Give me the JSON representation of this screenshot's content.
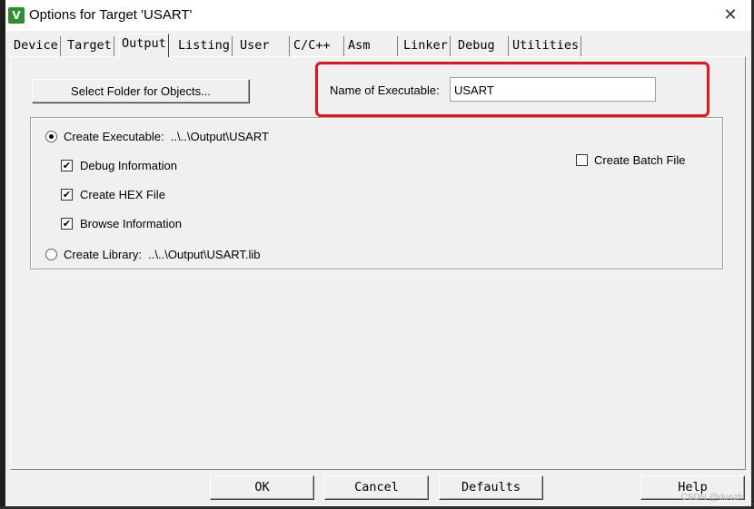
{
  "window": {
    "title": "Options for Target 'USART'",
    "icon": "V",
    "close_glyph": "✕"
  },
  "tabs": [
    {
      "label": "Device"
    },
    {
      "label": "Target"
    },
    {
      "label": "Output",
      "active": true
    },
    {
      "label": "Listing"
    },
    {
      "label": "User"
    },
    {
      "label": "C/C++"
    },
    {
      "label": "Asm"
    },
    {
      "label": "Linker"
    },
    {
      "label": "Debug"
    },
    {
      "label": "Utilities"
    }
  ],
  "output": {
    "select_folder_label": "Select Folder for Objects...",
    "name_of_executable_label": "Name of Executable:",
    "name_of_executable_value": "USART",
    "create_executable": {
      "label": "Create Executable:  ..\\..\\Output\\USART",
      "selected": true
    },
    "debug_information": {
      "label": "Debug Information",
      "checked": true
    },
    "create_hex_file": {
      "label": "Create HEX File",
      "checked": true
    },
    "browse_information": {
      "label": "Browse Information",
      "checked": true
    },
    "create_library": {
      "label": "Create Library:  ..\\..\\Output\\USART.lib",
      "selected": false
    },
    "create_batch_file": {
      "label": "Create Batch File",
      "checked": false
    }
  },
  "footer": {
    "ok": "OK",
    "cancel": "Cancel",
    "defaults": "Defaults",
    "help": "Help"
  },
  "watermark": "CSDN @duozh",
  "colors": {
    "highlight_border": "#e8141c",
    "icon_green": "#2f8f2f"
  }
}
